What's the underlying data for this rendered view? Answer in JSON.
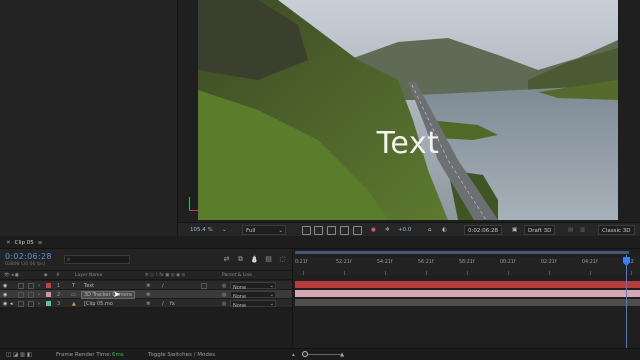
{
  "viewer": {
    "overlay_text": "Text",
    "zoom": "105.4",
    "zoom_unit": "%",
    "resolution": "Full",
    "exposure": "+0.0",
    "timecode": "0:02:06:28",
    "renderer": "Draft 3D",
    "view_mode": "Classic 3D"
  },
  "timeline": {
    "tab_label": "Clip 05",
    "current_time": "0:02:06:28",
    "frame_info": "03808 (30.00 fps)",
    "columns": {
      "layer_name": "Layer Name",
      "number": "#",
      "parent": "Parent & Link"
    },
    "layers": [
      {
        "index": "1",
        "type_icon": "T",
        "name": "Text",
        "color": "#c94040",
        "parent": "None"
      },
      {
        "index": "2",
        "type_icon": "▭",
        "name": "3D Tracker Camera",
        "color": "#d88fa0",
        "parent": "None"
      },
      {
        "index": "3",
        "type_icon": "▲",
        "name": "[Clip 05.mo",
        "color": "#5ec19a",
        "parent": "None"
      }
    ],
    "ruler_labels": [
      "0:21f",
      "52:21f",
      "54:21f",
      "56:21f",
      "58:21f",
      "00:21f",
      "02:21f",
      "04:21f",
      "06:2"
    ],
    "track_colors": [
      "#b83c3c",
      "#d7a6b2",
      "#4e4e4e"
    ]
  },
  "bottom_bar": {
    "render_time_label": "Frame Render Time:",
    "render_time_value": "6ms",
    "toggle_label": "Toggle Switches / Modes"
  }
}
